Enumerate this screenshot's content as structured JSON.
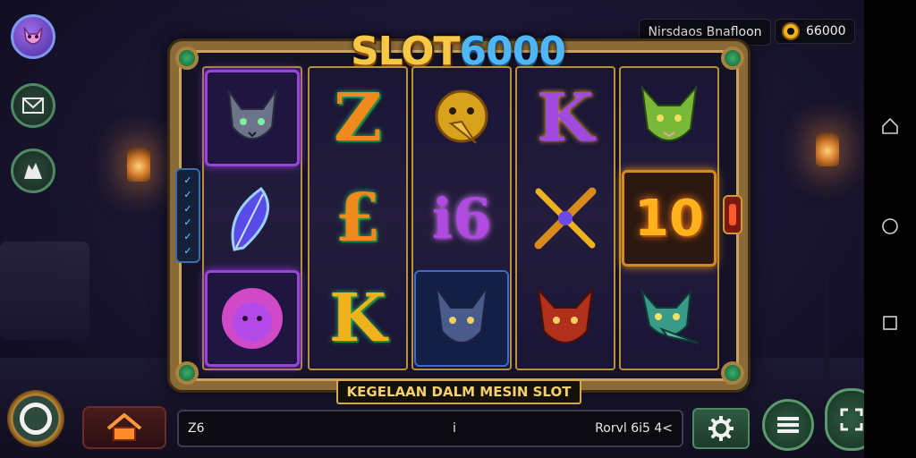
{
  "game": {
    "title_text": "SLOT",
    "title_number": "6000",
    "banner": "KEGELAAN DALM MESIN SLOT"
  },
  "player": {
    "name": "Nirsdaos Bnafloon",
    "coins": "66000"
  },
  "reels": [
    [
      {
        "name": "cat-symbol",
        "icon": "grey-cat-icon",
        "style": "highlight"
      },
      {
        "name": "feather-symbol",
        "icon": "blue-feather-icon",
        "style": "plain"
      },
      {
        "name": "lion-symbol",
        "icon": "pink-lion-icon",
        "style": "highlight"
      }
    ],
    [
      {
        "name": "letter-symbol",
        "text": "Z",
        "color": "#f08a1c"
      },
      {
        "name": "letter-symbol",
        "text": "£",
        "color": "#f08a1c"
      },
      {
        "name": "letter-symbol",
        "text": "K",
        "color": "#f0b21c"
      }
    ],
    [
      {
        "name": "bird-symbol",
        "icon": "gold-bird-icon",
        "style": "plain"
      },
      {
        "name": "number-symbol",
        "text": "i6",
        "color": "#b04ae0"
      },
      {
        "name": "wolf-symbol",
        "icon": "blue-wolf-icon",
        "style": "blue"
      }
    ],
    [
      {
        "name": "letter-symbol",
        "text": "K",
        "color": "#a04ae0"
      },
      {
        "name": "crossed-swords-symbol",
        "icon": "crossed-swords-icon",
        "style": "plain"
      },
      {
        "name": "fox-symbol",
        "icon": "red-fox-icon",
        "style": "plain"
      }
    ],
    [
      {
        "name": "green-cat-symbol",
        "icon": "green-cat-icon",
        "style": "plain"
      },
      {
        "name": "number-symbol",
        "text": "10",
        "color": "#ffb21c"
      },
      {
        "name": "croc-symbol",
        "icon": "teal-croc-icon",
        "style": "plain"
      }
    ]
  ],
  "bottom_bar": {
    "left": "Z6",
    "middle": "i",
    "right": "Rorvl 6i5 4<"
  },
  "colors": {
    "accent_gold": "#d4a94a",
    "accent_green": "#4d8a63",
    "title_gold": "#f6c846",
    "title_blue": "#4fb6f5"
  }
}
